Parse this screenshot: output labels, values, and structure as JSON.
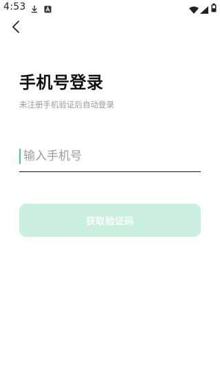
{
  "status_bar": {
    "time": "4:53",
    "icons": [
      "download-icon",
      "a-icon",
      "wifi-icon",
      "signal-icon",
      "battery-icon"
    ]
  },
  "nav": {
    "back_icon": "chevron-left-icon"
  },
  "header": {
    "title": "手机号登录",
    "subtitle": "未注册手机验证后自动登录"
  },
  "form": {
    "phone_placeholder": "输入手机号",
    "phone_value": "",
    "cursor_color": "#3ec996",
    "submit_label": "获取验证码",
    "submit_color": "#c9f0df",
    "submit_enabled": false
  }
}
